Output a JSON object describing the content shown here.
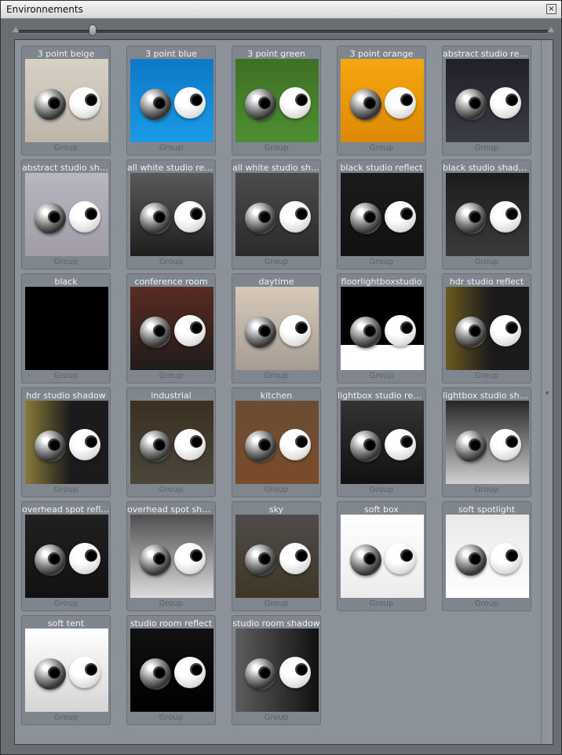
{
  "window": {
    "title": "Environnements"
  },
  "slider": {
    "value": 0.14
  },
  "colors": {
    "beige": "#d8d2c7",
    "blue": "#1d8fd8",
    "green": "#4f7f2b",
    "orange": "#f0a713",
    "dark": "#2f3033",
    "black": "#000000"
  },
  "items": [
    {
      "label": "3 point beige",
      "type": "Group",
      "bg": "linear-gradient(#d8d1c6,#bdb5aa)"
    },
    {
      "label": "3 point blue",
      "type": "Group",
      "bg": "linear-gradient(#0d78c8,#1a9be5)"
    },
    {
      "label": "3 point green",
      "type": "Group",
      "bg": "linear-gradient(#3f6f25,#4e8e31)"
    },
    {
      "label": "3 point orange",
      "type": "Group",
      "bg": "linear-gradient(#f6a60e,#dc8a05)"
    },
    {
      "label": "abstract studio reflect",
      "type": "Group",
      "bg": "linear-gradient(#1f2028,#3b3d43)"
    },
    {
      "label": "abstract studio sha ...",
      "type": "Group",
      "bg": "linear-gradient(#b8b6c0,#9f9ca8)"
    },
    {
      "label": "all white studio reflect",
      "type": "Group",
      "bg": "linear-gradient(#5a5a5a,#1e1e1e)"
    },
    {
      "label": "all white studio shad...",
      "type": "Group",
      "bg": "linear-gradient(#4b4b4b,#2b2b2b)"
    },
    {
      "label": "black studio reflect",
      "type": "Group",
      "bg": "linear-gradient(#1b1b1b,#111111)"
    },
    {
      "label": "black studio shadow",
      "type": "Group",
      "bg": "linear-gradient(#1c1c1c,#3a3a3a)"
    },
    {
      "label": "black",
      "type": "Group",
      "bg": "#000000"
    },
    {
      "label": "conference room",
      "type": "Group",
      "bg": "linear-gradient(#5a2b22,#1f1b1a)"
    },
    {
      "label": "daytime",
      "type": "Group",
      "bg": "linear-gradient(#d6c9ba,#a69c92)"
    },
    {
      "label": "floorlightboxstudio",
      "type": "Group",
      "bg": "linear-gradient(#000 0 70%,#fff 70%)"
    },
    {
      "label": "hdr studio reflect",
      "type": "Group",
      "bg": "linear-gradient(90deg,#6a5a20,#1a1a1a 55%)"
    },
    {
      "label": "hdr studio shadow",
      "type": "Group",
      "bg": "linear-gradient(90deg,#8a7a3a,#1b1b1b 55%)"
    },
    {
      "label": "industrial",
      "type": "Group",
      "bg": "linear-gradient(#3b3021,#4a473b)"
    },
    {
      "label": "kitchen",
      "type": "Group",
      "bg": "linear-gradient(#6a4d34,#7a4b2b)"
    },
    {
      "label": "lightbox studio reflect",
      "type": "Group",
      "bg": "linear-gradient(#333,#111)"
    },
    {
      "label": "lightbox studio shad...",
      "type": "Group",
      "bg": "linear-gradient(#262626,#cfcfcf)"
    },
    {
      "label": "overhead spot reflect",
      "type": "Group",
      "bg": "linear-gradient(#202020,#121212)"
    },
    {
      "label": "overhead spot shad...",
      "type": "Group",
      "bg": "linear-gradient(#4f4f4f,#dcdcdc)"
    },
    {
      "label": "sky",
      "type": "Group",
      "bg": "linear-gradient(#4f4b4a,#3f3626)"
    },
    {
      "label": "soft box",
      "type": "Group",
      "bg": "linear-gradient(#ffffff,#ececec)"
    },
    {
      "label": "soft spotlight",
      "type": "Group",
      "bg": "linear-gradient(#e9e9e9,#ffffff)"
    },
    {
      "label": "soft tent",
      "type": "Group",
      "bg": "linear-gradient(#ffffff,#d5d5d5)"
    },
    {
      "label": "studio room reflect",
      "type": "Group",
      "bg": "linear-gradient(#111,#000)"
    },
    {
      "label": "studio room shadow",
      "type": "Group",
      "bg": "linear-gradient(90deg,#5d5d5d,#111)"
    }
  ]
}
